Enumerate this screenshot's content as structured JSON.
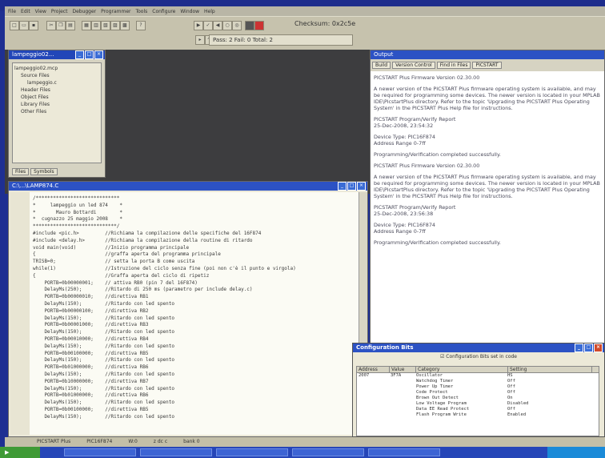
{
  "menu": [
    "File",
    "Edit",
    "View",
    "Project",
    "Debugger",
    "Programmer",
    "Tools",
    "Configure",
    "Window",
    "Help"
  ],
  "toolbar": {
    "checksum_label": "Checksum: 0x2c5e",
    "test_status": "Pass: 2 Fail: 0 Total: 2"
  },
  "project_window": {
    "title": "lampeggio02...",
    "tree": [
      "lampeggio02.mcp",
      "Source Files",
      "lampeggio.c",
      "Header Files",
      "Object Files",
      "Library Files",
      "Other Files"
    ],
    "tabs": [
      "Files",
      "Symbols"
    ]
  },
  "code_window": {
    "title": "C:\\...\\LAMP874.C",
    "lines": [
      "/*****************************",
      "*     lampeggio un led 874    *",
      "*       Mauro Bottardi        *",
      "*  cugnazzo 25 maggio 2008    *",
      "*****************************/",
      "#include <pic.h>         //Richiama la compilazione delle specifiche del 16F874",
      "#include <delay.h>       //Richiama la compilazione della routine di ritardo",
      "void main(void)          //Inizio programma principale",
      "{                        //graffa aperta del programma principale",
      "TRISB=0;                 // setta la porta B come uscita",
      "while(1)                 //Istruzione del ciclo senza fine (poi non c'è il punto e virgola)",
      "{                        //Graffa aperta del ciclo di ripetiz",
      "    PORTB=0b00000001;    // attiva RB0 (pin 7 del 16F874)",
      "    DelayMs(250);        //Ritardo di 250 ms (parametro per include delay.c)",
      "    PORTB=0b00000010;    //direttiva RB1",
      "    DelayMs(150);        //Ritardo con led spento",
      "    PORTB=0b00000100;    //direttiva RB2",
      "    DelayMs(150);        //Ritardo con led spento",
      "    PORTB=0b00001000;    //direttiva RB3",
      "    DelayMs(150);        //Ritardo con led spento",
      "    PORTB=0b00010000;    //direttiva RB4",
      "    DelayMs(150);        //Ritardo con led spento",
      "    PORTB=0b00100000;    //direttiva RB5",
      "    DelayMs(150);        //Ritardo con led spento",
      "    PORTB=0b01000000;    //direttiva RB6",
      "    DelayMs(150);        //Ritardo con led spento",
      "    PORTB=0b10000000;    //direttiva RB7",
      "    DelayMs(150);        //Ritardo con led spento",
      "    PORTB=0b01000000;    //direttiva RB6",
      "    DelayMs(150);        //Ritardo con led spento",
      "    PORTB=0b00100000;    //direttiva RB5",
      "    DelayMs(150);        //Ritardo con led spento"
    ]
  },
  "output_window": {
    "title": "Output",
    "tabs": [
      "Build",
      "Version Control",
      "Find in Files",
      "PICSTART"
    ],
    "paragraphs": [
      "PICSTART Plus Firmware Version 02.30.00",
      "A newer version of the PICSTART Plus firmware operating system is available, and may be required for programming some devices. The newer version is located in your MPLAB IDE\\PicstartPlus directory. Refer to the topic 'Upgrading the PICSTART Plus Operating System' in the PICSTART Plus Help file for instructions.",
      "PICSTART Program/Verify Report\n25-Dec-2008, 23:54:32",
      "Device Type: PIC16F874\nAddress Range 0-7ff",
      "Programming/Verification completed successfully.",
      "PICSTART Plus Firmware Version 02.30.00",
      "A newer version of the PICSTART Plus firmware operating system is available, and may be required for programming some devices. The newer version is located in your MPLAB IDE\\PicstartPlus directory. Refer to the topic 'Upgrading the PICSTART Plus Operating System' in the PICSTART Plus Help file for instructions.",
      "PICSTART Program/Verify Report\n25-Dec-2008, 23:56:38",
      "Device Type: PIC16F874\nAddress Range 0-7ff",
      "Programming/Verification completed successfully."
    ]
  },
  "config_window": {
    "title": "Configuration Bits",
    "checkbox_label": "Configuration Bits set in code",
    "headers": [
      "Address",
      "Value",
      "Category",
      "Setting"
    ],
    "rows": [
      [
        "2007",
        "3F7A",
        "Oscillator",
        "HS"
      ],
      [
        "",
        "",
        "Watchdog Timer",
        "Off"
      ],
      [
        "",
        "",
        "Power Up Timer",
        "Off"
      ],
      [
        "",
        "",
        "Code Protect",
        "Off"
      ],
      [
        "",
        "",
        "Brown Out Detect",
        "On"
      ],
      [
        "",
        "",
        "Low Voltage Program",
        "Disabled"
      ],
      [
        "",
        "",
        "Data EE Read Protect",
        "Off"
      ],
      [
        "",
        "",
        "Flash Program Write",
        "Enabled"
      ]
    ]
  },
  "statusbar": {
    "programmer": "PICSTART Plus",
    "device": "PIC16F874",
    "item3": "W:0",
    "item4": "z dc c",
    "item5": "bank 0"
  }
}
